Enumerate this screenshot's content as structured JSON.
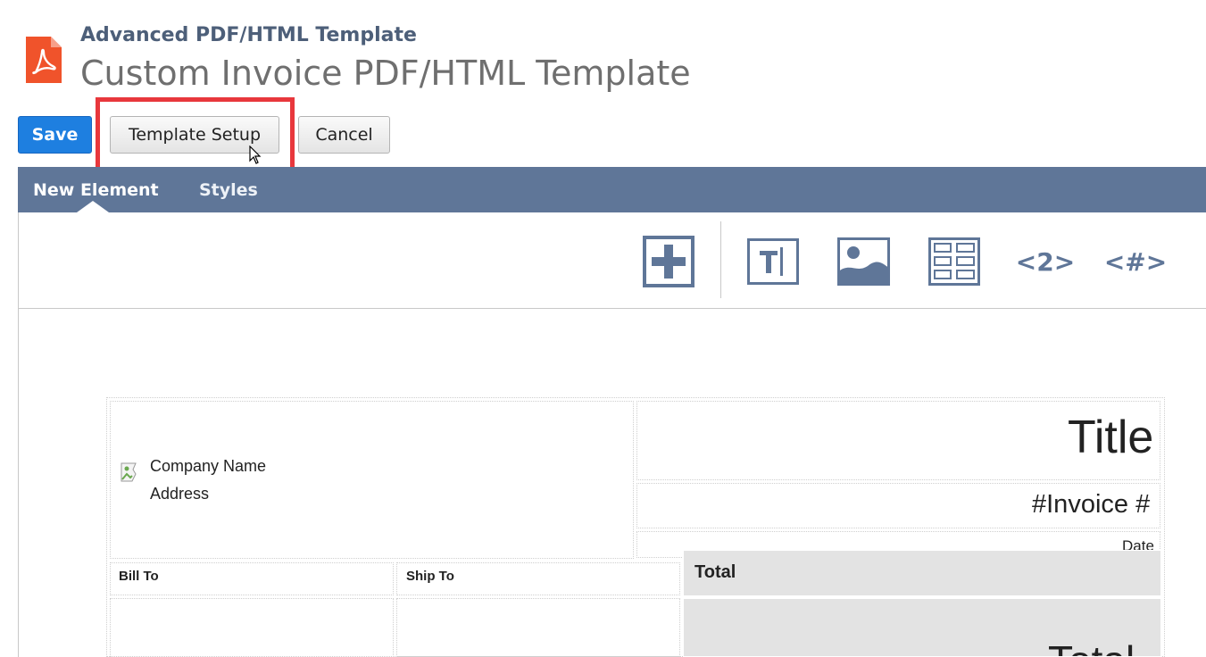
{
  "header": {
    "record_type": "Advanced PDF/HTML Template",
    "title": "Custom Invoice PDF/HTML Template"
  },
  "buttons": {
    "save": "Save",
    "template_setup": "Template Setup",
    "cancel": "Cancel"
  },
  "tabs": [
    {
      "label": "New Element",
      "active": true
    },
    {
      "label": "Styles",
      "active": false
    }
  ],
  "toolbar": {
    "icons": [
      "add-element-icon",
      "text-field-icon",
      "image-icon",
      "table-icon",
      "page-number-icon",
      "field-placeholder-icon"
    ],
    "page_number_label": "<2>",
    "field_label": "<#>"
  },
  "template": {
    "company_name": "Company Name",
    "address": "Address",
    "title": "Title",
    "invoice_number": "#Invoice #",
    "date": "Date",
    "bill_to": "Bill To",
    "ship_to": "Ship To",
    "total_header": "Total",
    "total_value": "Total"
  },
  "colors": {
    "save_button": "#1e7fe0",
    "tab_bar": "#5f7698",
    "highlight_box": "#e8373c",
    "pdf_icon": "#f25022"
  }
}
